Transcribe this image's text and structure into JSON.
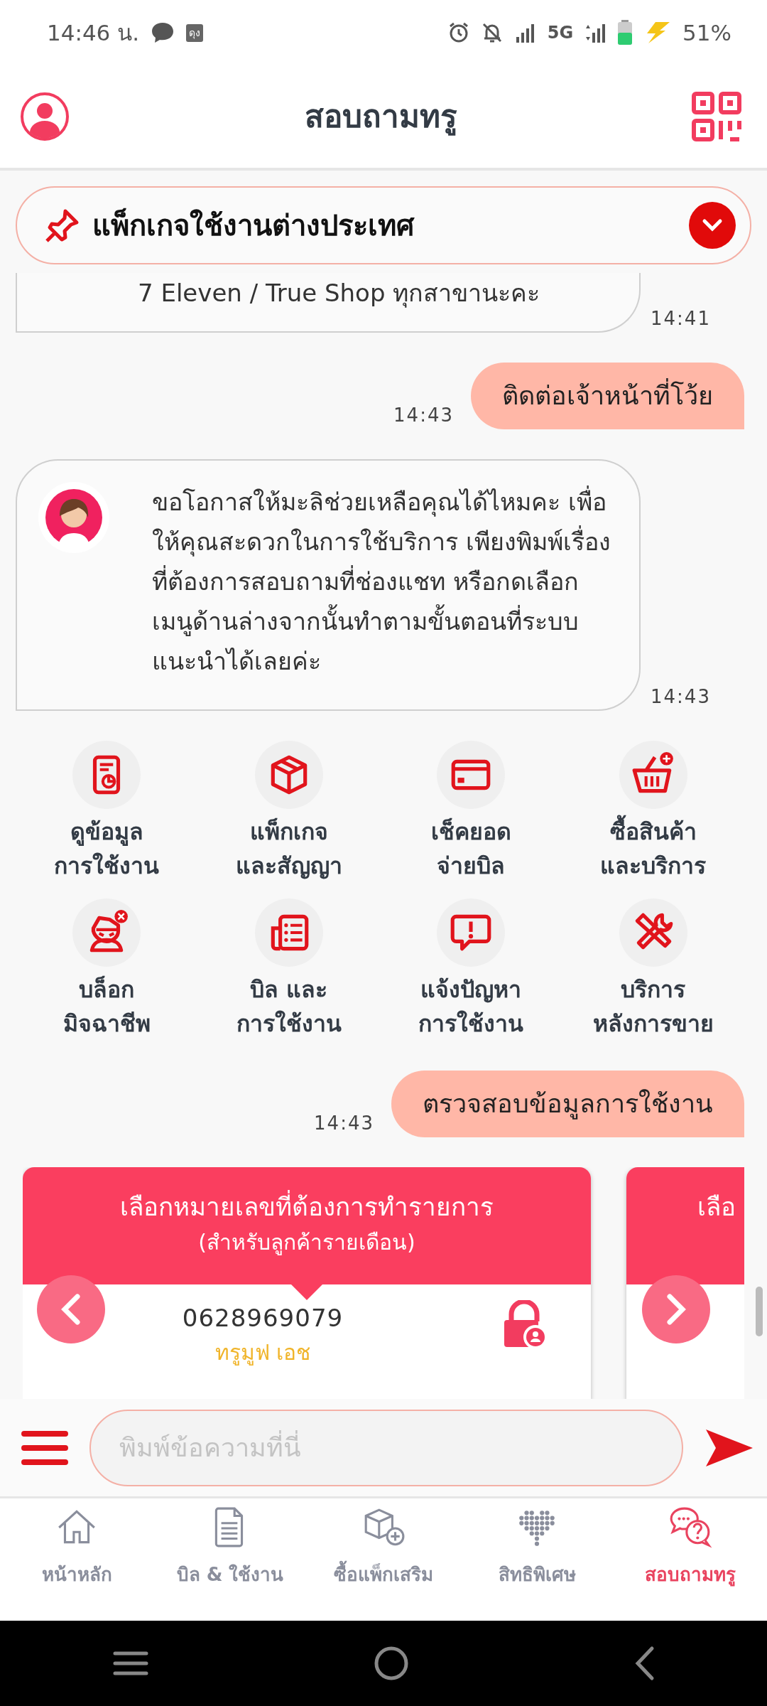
{
  "status_bar": {
    "time": "14:46 น.",
    "badge": "ดุง",
    "network": "5G",
    "battery": "51%"
  },
  "header": {
    "title": "สอบถามทรู"
  },
  "pinned": {
    "text": "แพ็กเกจใช้งานต่างประเทศ"
  },
  "messages": [
    {
      "kind": "bot",
      "lines": [
        "7 Eleven / True Shop ทุกสาขานะคะ"
      ],
      "time": "14:41"
    },
    {
      "kind": "user",
      "text": "ติดต่อเจ้าหน้าที่โว้ย",
      "time": "14:43"
    },
    {
      "kind": "bot_avatar",
      "text": "ขอโอกาสให้มะลิช่วยเหลือคุณได้ไหมคะ เพื่อให้คุณสะดวกในการใช้บริการ เพียงพิมพ์เรื่องที่ต้องการสอบถามที่ช่องแชท หรือกดเลือกเมนูด้านล่างจากนั้นทำตามขั้นตอนที่ระบบแนะนำได้เลยค่ะ",
      "time": "14:43"
    },
    {
      "kind": "menu",
      "items": [
        {
          "label": "ดูข้อมูล\nการใช้งาน"
        },
        {
          "label": "แพ็กเกจ\nและสัญญา"
        },
        {
          "label": "เช็คยอด\nจ่ายบิล"
        },
        {
          "label": "ซื้อสินค้า\nและบริการ"
        },
        {
          "label": "บล็อก\nมิจฉาชีพ"
        },
        {
          "label": "บิล และ\nการใช้งาน"
        },
        {
          "label": "แจ้งปัญหา\nการใช้งาน"
        },
        {
          "label": "บริการ\nหลังการขาย"
        }
      ]
    },
    {
      "kind": "user",
      "text": "ตรวจสอบข้อมูลการใช้งาน",
      "time": "14:43"
    },
    {
      "kind": "carousel",
      "cards": [
        {
          "title": "เลือกหมายเลขที่ต้องการทำรายการ",
          "subtitle": "(สำหรับลูกค้ารายเดือน)",
          "number": "0628969079",
          "network": "ทรูมูฟ เอช"
        },
        {
          "title": "เลือ"
        }
      ]
    }
  ],
  "composer": {
    "placeholder": "พิมพ์ข้อความที่นี่"
  },
  "bottom_nav": [
    {
      "label": "หน้าหลัก",
      "selected": false
    },
    {
      "label": "บิล & ใช้งาน",
      "selected": false
    },
    {
      "label": "ซื้อแพ็กเสริม",
      "selected": false
    },
    {
      "label": "สิทธิพิเศษ",
      "selected": false
    },
    {
      "label": "สอบถามทรู",
      "selected": true
    }
  ]
}
